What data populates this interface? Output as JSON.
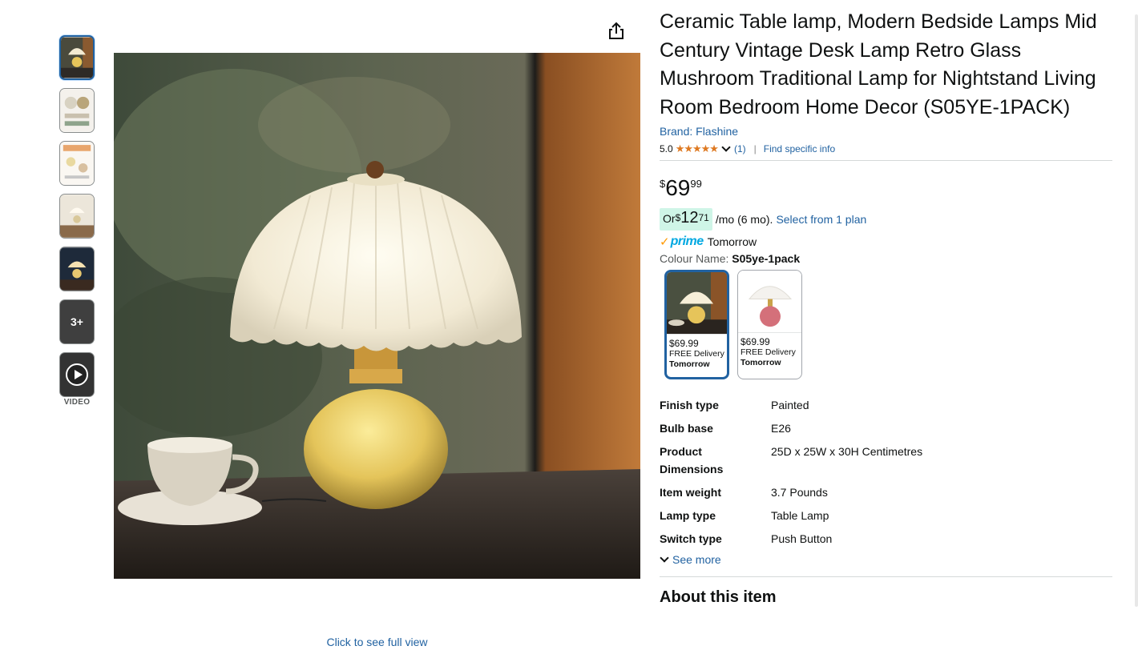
{
  "product": {
    "title": "Ceramic Table lamp, Modern Bedside Lamps Mid Century Vintage Desk Lamp Retro Glass Mushroom Traditional Lamp for Nightstand Living Room Bedroom Home Decor (S05YE-1PACK)",
    "brand": "Brand: Flashine",
    "rating": "5.0",
    "stars": "★★★★★",
    "review_count": "(1)",
    "find_info": "Find specific info"
  },
  "price": {
    "symbol": "$",
    "whole": "69",
    "fraction": "99"
  },
  "emi": {
    "prefix": "Or ",
    "symbol": "$",
    "amount": "12",
    "fraction": "71",
    "suffix": "/mo (6 mo).",
    "link": "Select from 1 plan"
  },
  "delivery": {
    "check": "✓",
    "prime": "prime",
    "when": "Tomorrow"
  },
  "colour": {
    "label": "Colour Name: ",
    "value": "S05ye-1pack",
    "options": [
      {
        "price": "$69.99",
        "delivery": "FREE Delivery",
        "day": "Tomorrow"
      },
      {
        "price": "$69.99",
        "delivery": "FREE Delivery",
        "day": "Tomorrow"
      }
    ]
  },
  "specs": [
    {
      "key": "Finish type",
      "value": "Painted"
    },
    {
      "key": "Bulb base",
      "value": "E26"
    },
    {
      "key": "Product Dimensions",
      "value": "25D x 25W x 30H Centimetres"
    },
    {
      "key": "Item weight",
      "value": "3.7 Pounds"
    },
    {
      "key": "Lamp type",
      "value": "Table Lamp"
    },
    {
      "key": "Switch type",
      "value": "Push Button"
    }
  ],
  "see_more": "See more",
  "about_heading": "About this item",
  "gallery": {
    "more_label": "3+",
    "video_label": "VIDEO",
    "full_view": "Click to see full view"
  },
  "colors": {
    "link": "#2162a1",
    "star": "#de7921",
    "emi_badge": "#cff5e7",
    "prime_blue": "#00a8e1",
    "prime_check": "#ff9900"
  }
}
